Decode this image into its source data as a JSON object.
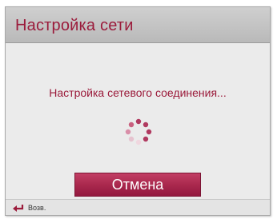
{
  "dialog": {
    "title": "Настройка сети",
    "message": "Настройка сетевого соединения...",
    "cancel_label": "Отмена"
  },
  "footer": {
    "back_label": "Возв.",
    "back_icon": "back-arrow-icon"
  },
  "spinner": {
    "icon": "loading-spinner-icon"
  },
  "colors": {
    "accent": "#9b1b3b",
    "button": "#a8274c",
    "spinner_active": "#b03a60",
    "spinner_faded": "#e6c3cf"
  }
}
